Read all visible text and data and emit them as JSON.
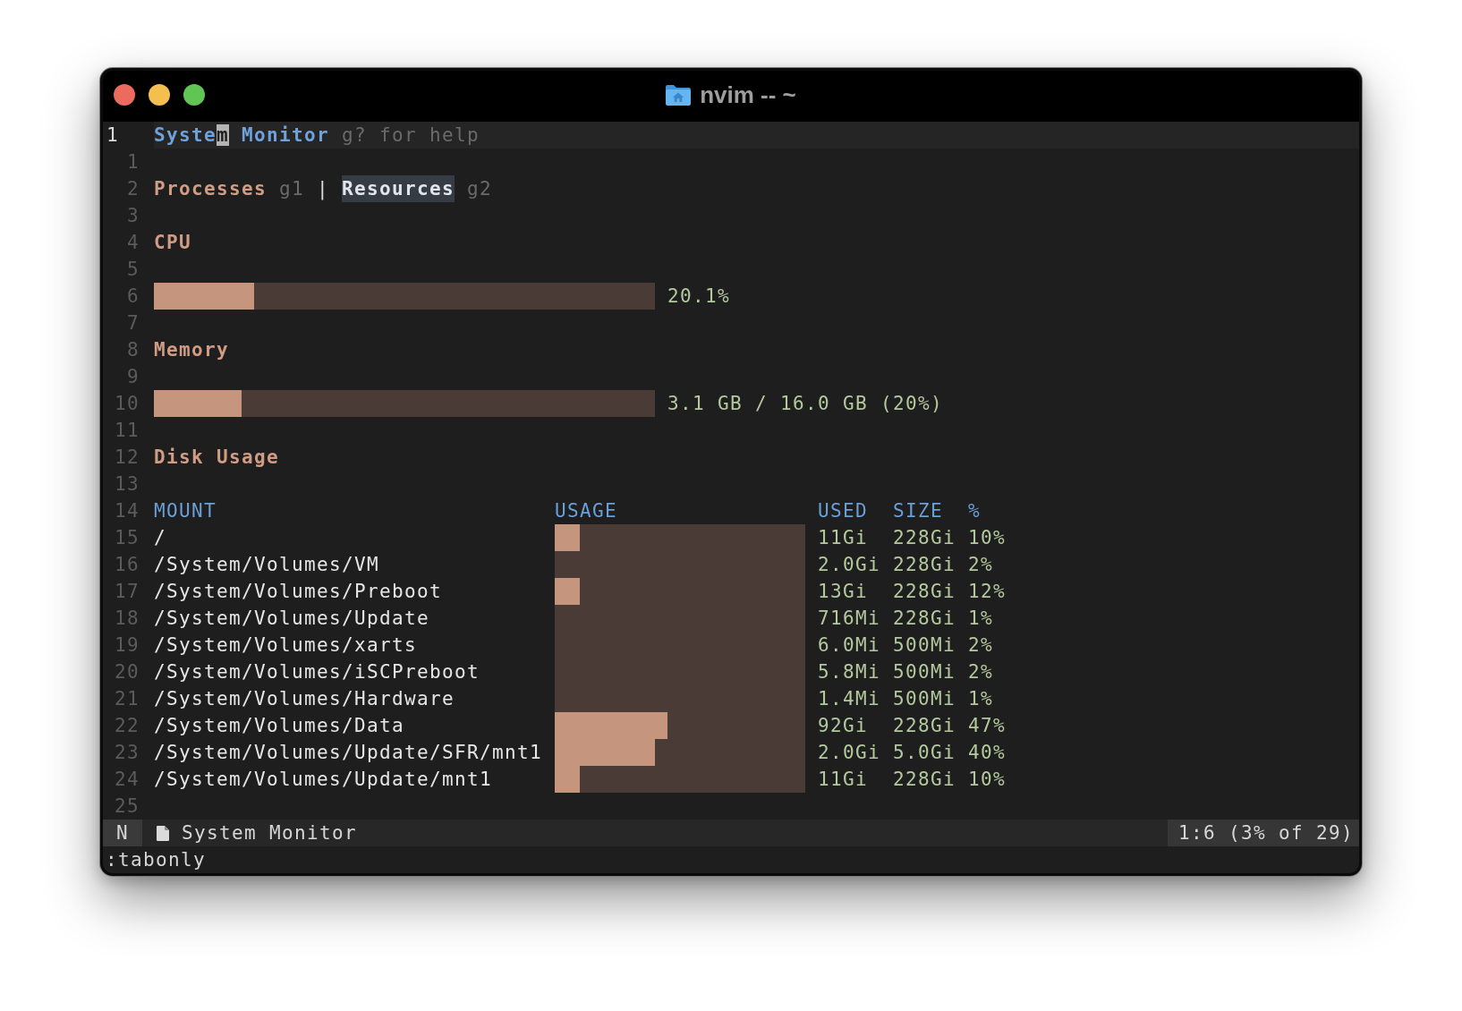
{
  "window": {
    "title": "nvim -- ~"
  },
  "buffer": [
    {
      "number": "1",
      "current": true,
      "kind": "title",
      "parts": [
        {
          "text": "Syste",
          "cursor": false
        },
        {
          "text": "m",
          "cursor": true
        },
        {
          "text": " Monitor",
          "cursor": false
        }
      ],
      "hint": "g? for help"
    },
    {
      "number": "1",
      "current": false,
      "kind": "blank"
    },
    {
      "number": "2",
      "current": false,
      "kind": "tabs",
      "tabs": [
        {
          "label": "Processes",
          "key": "g1",
          "selected": false
        },
        {
          "label": "Resources",
          "key": "g2",
          "selected": true
        }
      ],
      "separator": "|"
    },
    {
      "number": "3",
      "current": false,
      "kind": "blank"
    },
    {
      "number": "4",
      "current": false,
      "kind": "heading",
      "text": "CPU"
    },
    {
      "number": "5",
      "current": false,
      "kind": "blank"
    },
    {
      "number": "6",
      "current": false,
      "kind": "meter",
      "level": 0.2,
      "reading": "20.1%"
    },
    {
      "number": "7",
      "current": false,
      "kind": "blank"
    },
    {
      "number": "8",
      "current": false,
      "kind": "heading",
      "text": "Memory"
    },
    {
      "number": "9",
      "current": false,
      "kind": "blank"
    },
    {
      "number": "10",
      "current": false,
      "kind": "meter",
      "level": 0.175,
      "reading": "3.1 GB / 16.0 GB (20%)"
    },
    {
      "number": "11",
      "current": false,
      "kind": "blank"
    },
    {
      "number": "12",
      "current": false,
      "kind": "heading",
      "text": "Disk Usage"
    },
    {
      "number": "13",
      "current": false,
      "kind": "blank"
    },
    {
      "number": "14",
      "current": false,
      "kind": "table_header",
      "columns": [
        "MOUNT",
        "USAGE",
        "USED",
        "SIZE",
        "%"
      ]
    },
    {
      "number": "15",
      "current": false,
      "kind": "disk_row",
      "mount": "/",
      "level": 0.1,
      "used": "11Gi",
      "size": "228Gi",
      "percent": "10%"
    },
    {
      "number": "16",
      "current": false,
      "kind": "disk_row",
      "mount": "/System/Volumes/VM",
      "used": "2.0Gi",
      "size": "228Gi",
      "percent": "2%"
    },
    {
      "number": "17",
      "current": false,
      "kind": "disk_row",
      "mount": "/System/Volumes/Preboot",
      "level": 0.1,
      "used": "13Gi",
      "size": "228Gi",
      "percent": "12%"
    },
    {
      "number": "18",
      "current": false,
      "kind": "disk_row",
      "mount": "/System/Volumes/Update",
      "used": "716Mi",
      "size": "228Gi",
      "percent": "1%"
    },
    {
      "number": "19",
      "current": false,
      "kind": "disk_row",
      "mount": "/System/Volumes/xarts",
      "used": "6.0Mi",
      "size": "500Mi",
      "percent": "2%"
    },
    {
      "number": "20",
      "current": false,
      "kind": "disk_row",
      "mount": "/System/Volumes/iSCPreboot",
      "used": "5.8Mi",
      "size": "500Mi",
      "percent": "2%"
    },
    {
      "number": "21",
      "current": false,
      "kind": "disk_row",
      "mount": "/System/Volumes/Hardware",
      "used": "1.4Mi",
      "size": "500Mi",
      "percent": "1%"
    },
    {
      "number": "22",
      "current": false,
      "kind": "disk_row",
      "mount": "/System/Volumes/Data",
      "level": 0.45,
      "used": "92Gi",
      "size": "228Gi",
      "percent": "47%"
    },
    {
      "number": "23",
      "current": false,
      "kind": "disk_row",
      "mount": "/System/Volumes/Update/SFR/mnt1",
      "level": 0.4,
      "used": "2.0Gi",
      "size": "5.0Gi",
      "percent": "40%"
    },
    {
      "number": "24",
      "current": false,
      "kind": "disk_row",
      "mount": "/System/Volumes/Update/mnt1",
      "level": 0.1,
      "used": "11Gi",
      "size": "228Gi",
      "percent": "10%"
    },
    {
      "number": "25",
      "current": false,
      "kind": "blank"
    }
  ],
  "status_line": {
    "mode": "N",
    "file": "System Monitor",
    "position": "1:6 (3% of 29)"
  },
  "command_line": ":tabonly"
}
